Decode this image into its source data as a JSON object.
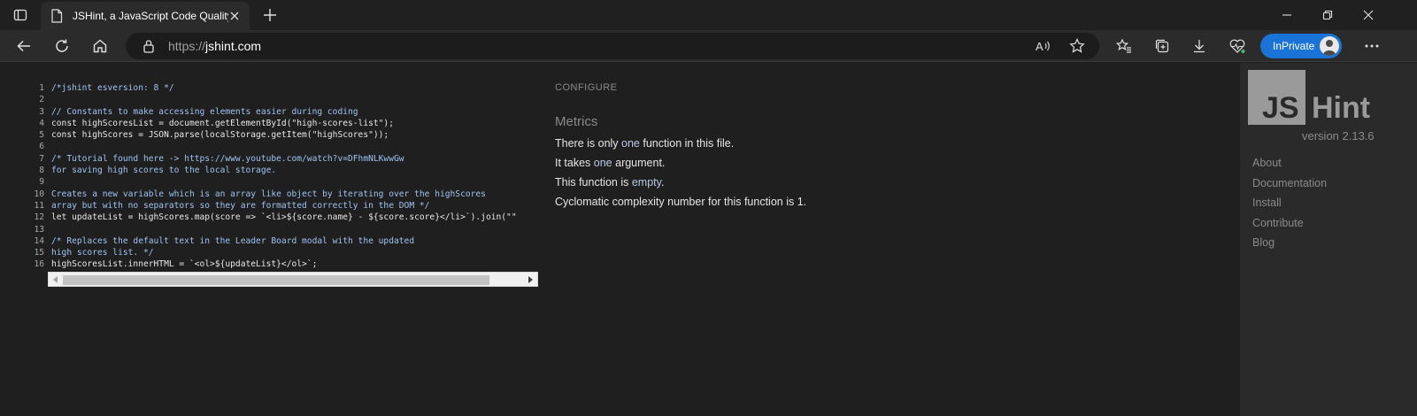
{
  "browser": {
    "tab": {
      "title": "JSHint, a JavaScript Code Quality"
    },
    "address": {
      "protocol": "https://",
      "host": "jshint.com"
    },
    "inprivate_label": "InPrivate"
  },
  "editor": {
    "lines": [
      {
        "n": "1",
        "text": "/*jshint esversion: 8 */",
        "comment": true
      },
      {
        "n": "2",
        "text": "",
        "comment": false
      },
      {
        "n": "3",
        "text": "// Constants to make accessing elements easier during coding",
        "comment": true
      },
      {
        "n": "4",
        "text": "const highScoresList = document.getElementById(\"high-scores-list\");",
        "comment": false
      },
      {
        "n": "5",
        "text": "const highScores = JSON.parse(localStorage.getItem(\"highScores\"));",
        "comment": false
      },
      {
        "n": "6",
        "text": "",
        "comment": false
      },
      {
        "n": "7",
        "text": "/* Tutorial found here -> https://www.youtube.com/watch?v=DFhmNLKwwGw",
        "comment": true
      },
      {
        "n": "8",
        "text": "for saving high scores to the local storage.",
        "comment": true
      },
      {
        "n": "9",
        "text": "",
        "comment": false
      },
      {
        "n": "10",
        "text": "Creates a new variable which is an array like object by iterating over the highScores",
        "comment": true
      },
      {
        "n": "11",
        "text": "array but with no separators so they are formatted correctly in the DOM */",
        "comment": true
      },
      {
        "n": "12",
        "text": "let updateList = highScores.map(score => `<li>${score.name} - ${score.score}</li>`).join(\"\"",
        "comment": false
      },
      {
        "n": "13",
        "text": "",
        "comment": false
      },
      {
        "n": "14",
        "text": "/* Replaces the default text in the Leader Board modal with the updated",
        "comment": true
      },
      {
        "n": "15",
        "text": "high scores list. */",
        "comment": true
      },
      {
        "n": "16",
        "text": "highScoresList.innerHTML = `<ol>${updateList}</ol>`;",
        "comment": false
      }
    ]
  },
  "report": {
    "configure": "CONFIGURE",
    "metrics_title": "Metrics",
    "metrics": [
      {
        "pre": "There is only ",
        "hl": "one",
        "post": " function in this file."
      },
      {
        "pre": "It takes ",
        "hl": "one",
        "post": " argument."
      },
      {
        "pre": "This function is ",
        "hl": "empty",
        "post": "."
      },
      {
        "pre": "Cyclomatic complexity number for this function is 1.",
        "hl": "",
        "post": ""
      }
    ]
  },
  "sidebar": {
    "logo_js": "JS",
    "logo_hint": "Hint",
    "version": "version 2.13.6",
    "links": [
      "About",
      "Documentation",
      "Install",
      "Contribute",
      "Blog"
    ]
  }
}
